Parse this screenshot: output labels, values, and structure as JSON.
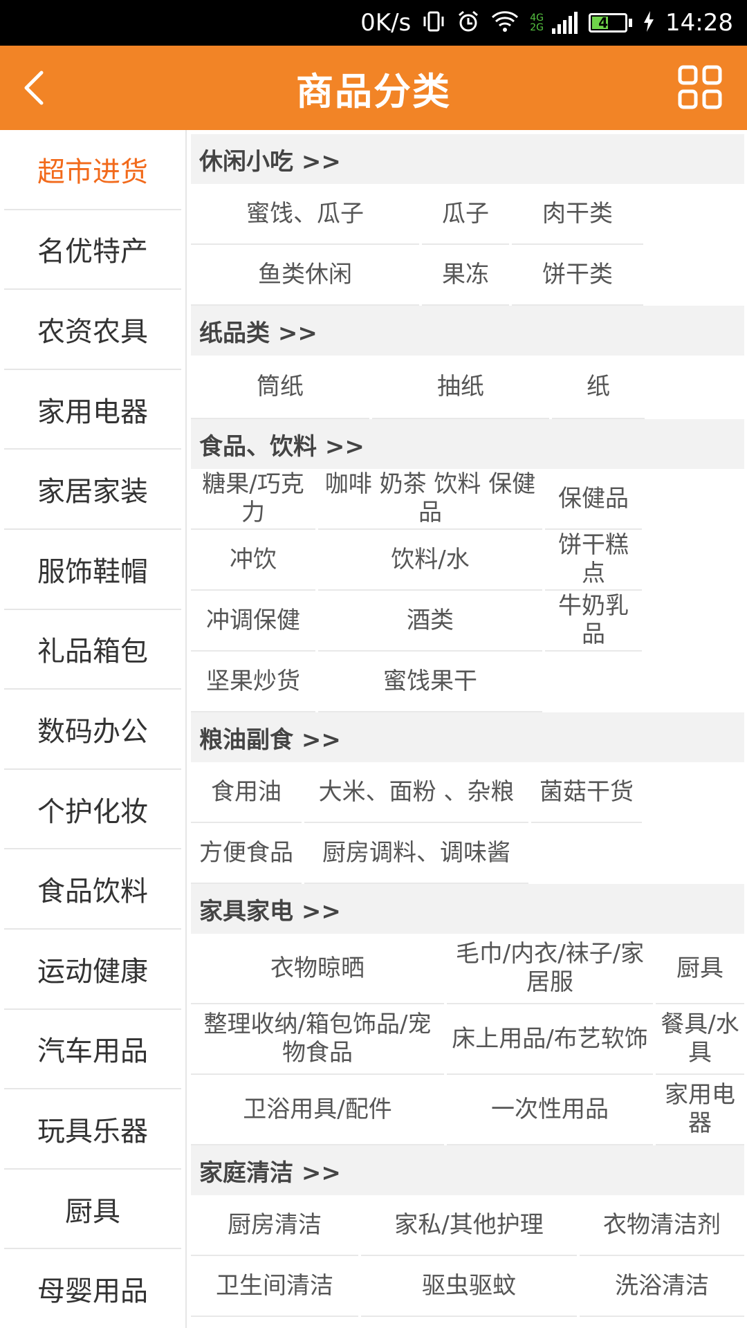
{
  "status_bar": {
    "speed": "0K/s",
    "network_4g": "4G",
    "network_2g": "2G",
    "battery": "47",
    "time": "14:28"
  },
  "header": {
    "title": "商品分类"
  },
  "sidebar": {
    "items": [
      {
        "label": "超市进货",
        "active": true
      },
      {
        "label": "名优特产"
      },
      {
        "label": "农资农具"
      },
      {
        "label": "家用电器"
      },
      {
        "label": "家居家装"
      },
      {
        "label": "服饰鞋帽"
      },
      {
        "label": "礼品箱包"
      },
      {
        "label": "数码办公"
      },
      {
        "label": "个护化妆"
      },
      {
        "label": "食品饮料"
      },
      {
        "label": "运动健康"
      },
      {
        "label": "汽车用品"
      },
      {
        "label": "玩具乐器"
      },
      {
        "label": "厨具"
      },
      {
        "label": "母婴用品"
      }
    ]
  },
  "sections": [
    {
      "title": "休闲小吃 >>",
      "rows": [
        [
          "蜜饯、瓜子",
          "瓜子",
          "肉干类"
        ],
        [
          "鱼类休闲",
          "果冻",
          "饼干类"
        ]
      ]
    },
    {
      "title": "纸品类 >>",
      "rows": [
        [
          "筒纸",
          "抽纸",
          "纸"
        ]
      ]
    },
    {
      "title": "食品、饮料 >>",
      "rows": [
        [
          "糖果/巧克力",
          "咖啡 奶茶 饮料 保健品",
          "保健品"
        ],
        [
          "冲饮",
          "饮料/水",
          "饼干糕点"
        ],
        [
          "冲调保健",
          "酒类",
          "牛奶乳品"
        ],
        [
          "坚果炒货",
          "蜜饯果干",
          ""
        ]
      ]
    },
    {
      "title": "粮油副食 >>",
      "rows": [
        [
          "食用油",
          "大米、面粉 、杂粮",
          "菌菇干货"
        ],
        [
          "方便食品",
          "厨房调料、调味酱",
          ""
        ]
      ]
    },
    {
      "title": "家具家电 >>",
      "rows": [
        [
          "衣物晾晒",
          "毛巾/内衣/袜子/家居服",
          "厨具"
        ],
        [
          "整理收纳/箱包饰品/宠物食品",
          "床上用品/布艺软饰",
          "餐具/水具"
        ],
        [
          "卫浴用具/配件",
          "一次性用品",
          "家用电器"
        ]
      ]
    },
    {
      "title": "家庭清洁 >>",
      "rows": [
        [
          "厨房清洁",
          "家私/其他护理",
          "衣物清洁剂"
        ],
        [
          "卫生间清洁",
          "驱虫驱蚊",
          "洗浴清洁"
        ]
      ]
    }
  ]
}
